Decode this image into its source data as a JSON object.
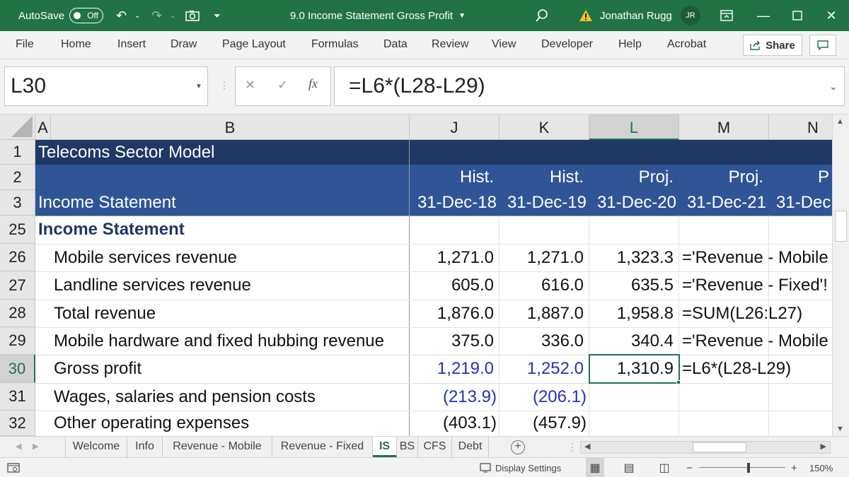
{
  "titlebar": {
    "autosave_label": "AutoSave",
    "autosave_state": "Off",
    "document_title": "9.0 Income Statement Gross Profit",
    "user_name": "Jonathan Rugg",
    "user_initials": "JR",
    "warning_icon": "warning-icon"
  },
  "ribbon": {
    "tabs": [
      "File",
      "Home",
      "Insert",
      "Draw",
      "Page Layout",
      "Formulas",
      "Data",
      "Review",
      "View",
      "Developer",
      "Help",
      "Acrobat"
    ],
    "share_label": "Share"
  },
  "formula_bar": {
    "name_box": "L30",
    "fx_label": "fx",
    "formula": "=L6*(L28-L29)"
  },
  "columns": {
    "A": "A",
    "B": "B",
    "J": "J",
    "K": "K",
    "L": "L",
    "M": "M",
    "N": "N"
  },
  "rows": {
    "r1": {
      "num": "1",
      "b": "Telecoms Sector Model"
    },
    "r2": {
      "num": "2",
      "j": "Hist.",
      "k": "Hist.",
      "l": "Proj.",
      "m": "Proj.",
      "n": "P"
    },
    "r3": {
      "num": "3",
      "b": "Income Statement",
      "j": "31-Dec-18",
      "k": "31-Dec-19",
      "l": "31-Dec-20",
      "m": "31-Dec-21",
      "n": "31-Dec"
    },
    "r25": {
      "num": "25",
      "b": "Income Statement"
    },
    "r26": {
      "num": "26",
      "b": "Mobile services revenue",
      "j": "1,271.0",
      "k": "1,271.0",
      "l": "1,323.3",
      "m": "='Revenue - Mobile"
    },
    "r27": {
      "num": "27",
      "b": "Landline services revenue",
      "j": "605.0",
      "k": "616.0",
      "l": "635.5",
      "m": "='Revenue - Fixed'!"
    },
    "r28": {
      "num": "28",
      "b": "Total revenue",
      "j": "1,876.0",
      "k": "1,887.0",
      "l": "1,958.8",
      "m": "=SUM(L26:L27)"
    },
    "r29": {
      "num": "29",
      "b": "Mobile hardware and fixed hubbing revenue",
      "j": "375.0",
      "k": "336.0",
      "l": "340.4",
      "m": "='Revenue - Mobile"
    },
    "r30": {
      "num": "30",
      "b": "Gross profit",
      "j": "1,219.0",
      "k": "1,252.0",
      "l": "1,310.9",
      "m": "=L6*(L28-L29)"
    },
    "r31": {
      "num": "31",
      "b": "Wages, salaries and pension costs",
      "j": "(213.9)",
      "k": "(206.1)"
    },
    "r32": {
      "num": "32",
      "b": "Other operating expenses",
      "j": "(403.1)",
      "k": "(457.9)"
    }
  },
  "sheet_tabs": [
    "Welcome",
    "Info",
    "Revenue - Mobile",
    "Revenue - Fixed",
    "IS",
    "BS",
    "CFS",
    "Debt"
  ],
  "active_sheet": "IS",
  "statusbar": {
    "display_settings": "Display Settings",
    "zoom_minus": "−",
    "zoom_plus": "+",
    "zoom_level": "150%"
  },
  "colors": {
    "excel_green": "#217346",
    "header_dark": "#1f3864",
    "header_mid": "#2f5597",
    "input_blue": "#2433b9"
  }
}
